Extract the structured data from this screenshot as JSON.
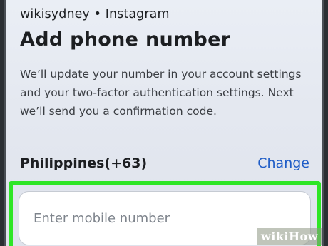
{
  "header": {
    "account_line": "wikisydney • Instagram",
    "title": "Add phone number"
  },
  "description": "We’ll update your number in your account settings and your two-factor authentication settings. Next we’ll send you a confirmation code.",
  "country": {
    "label": "Philippines(+63)",
    "change_label": "Change"
  },
  "phone_field": {
    "value": "",
    "placeholder": "Enter mobile number"
  },
  "watermark": {
    "wiki": "wiki",
    "how": "How"
  },
  "colors": {
    "link": "#1f5dc7",
    "highlight": "#2ee626",
    "background": "#e4e8f0"
  }
}
